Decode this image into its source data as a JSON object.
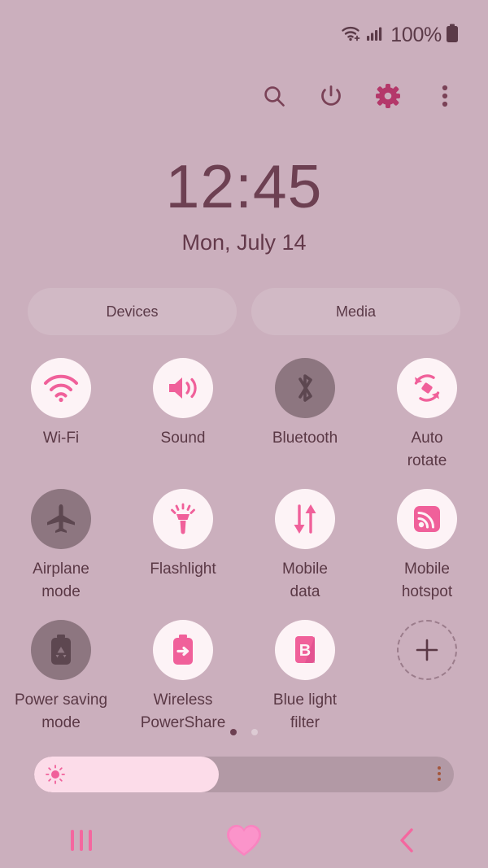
{
  "colors": {
    "background": "#cbafbd",
    "accent_pink": "#f0609a",
    "tile_on_bg": "#fdf3f6",
    "tile_off_bg": "#8d7680",
    "label_text": "#5a3845",
    "clock_text": "#6d4052",
    "slider_fill": "#fcdce9",
    "slider_track": "#b299a5"
  },
  "status_bar": {
    "wifi_icon": "wifi-icon",
    "signal_icon": "cellular-signal-icon",
    "battery_percent": "100%",
    "battery_icon": "battery-full-icon"
  },
  "header": {
    "icons": [
      {
        "name": "search-icon",
        "label": "Search"
      },
      {
        "name": "power-icon",
        "label": "Power"
      },
      {
        "name": "settings-gear-icon",
        "label": "Settings"
      },
      {
        "name": "more-options-icon",
        "label": "More options"
      }
    ]
  },
  "clock": {
    "time": "12:45",
    "date": "Mon, July 14"
  },
  "pills": [
    {
      "label": "Devices",
      "name": "devices-pill"
    },
    {
      "label": "Media",
      "name": "media-pill"
    }
  ],
  "tiles": [
    [
      {
        "label": "Wi-Fi",
        "icon": "wifi-icon",
        "state": "on"
      },
      {
        "label": "Sound",
        "icon": "sound-speaker-icon",
        "state": "on"
      },
      {
        "label": "Bluetooth",
        "icon": "bluetooth-icon",
        "state": "off"
      },
      {
        "label": "Auto\nrotate",
        "icon": "auto-rotate-icon",
        "state": "on"
      }
    ],
    [
      {
        "label": "Airplane\nmode",
        "icon": "airplane-icon",
        "state": "off"
      },
      {
        "label": "Flashlight",
        "icon": "flashlight-icon",
        "state": "on"
      },
      {
        "label": "Mobile\ndata",
        "icon": "mobile-data-icon",
        "state": "on"
      },
      {
        "label": "Mobile\nhotspot",
        "icon": "mobile-hotspot-icon",
        "state": "on"
      }
    ],
    [
      {
        "label": "Power saving\nmode",
        "icon": "power-saving-icon",
        "state": "off"
      },
      {
        "label": "Wireless\nPowerShare",
        "icon": "wireless-powershare-icon",
        "state": "on"
      },
      {
        "label": "Blue light\nfilter",
        "icon": "blue-light-filter-icon",
        "state": "on"
      },
      {
        "label": "",
        "icon": "add-tile-icon",
        "state": "add"
      }
    ]
  ],
  "page_dots": {
    "count": 2,
    "active_index": 0
  },
  "brightness": {
    "value_percent": 44,
    "sun_icon": "brightness-sun-icon",
    "menu_icon": "brightness-options-icon"
  },
  "nav_bar": {
    "recents": "recents-icon",
    "home": "home-heart-icon",
    "back": "back-chevron-icon"
  }
}
